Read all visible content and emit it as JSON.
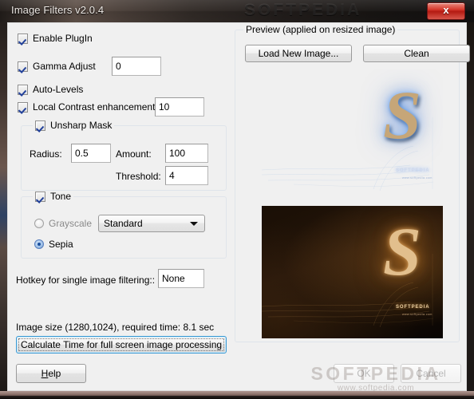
{
  "window": {
    "title": "Image Filters v2.0.4",
    "close_label": "x",
    "watermark": "SOFTPEDIA",
    "watermark_url": "www.softpedia.com"
  },
  "settings": {
    "enable_plugin": {
      "label": "Enable PlugIn",
      "checked": true
    },
    "gamma_adjust": {
      "label": "Gamma Adjust",
      "checked": true,
      "value": "0"
    },
    "auto_levels": {
      "label": "Auto-Levels",
      "checked": true
    },
    "local_contrast": {
      "label": "Local Contrast enhancement",
      "checked": true,
      "value": "10"
    }
  },
  "unsharp_mask": {
    "group_label": "Unsharp Mask",
    "checked": true,
    "radius_label": "Radius:",
    "radius_value": "0.5",
    "amount_label": "Amount:",
    "amount_value": "100",
    "threshold_label": "Threshold:",
    "threshold_value": "4"
  },
  "tone": {
    "group_label": "Tone",
    "checked": true,
    "grayscale_label": "Grayscale",
    "grayscale_selected": false,
    "sepia_label": "Sepia",
    "sepia_selected": true,
    "preset_value": "Standard",
    "preset_options": [
      "Standard"
    ]
  },
  "hotkey": {
    "label": "Hotkey for single image filtering::",
    "value": "None"
  },
  "status": {
    "image_info": "Image size (1280,1024), required time: 8.1 sec",
    "calculate_label": "Calculate Time for full screen image processing"
  },
  "preview": {
    "group_label": "Preview (applied on resized image)",
    "load_button": "Load New Image...",
    "clean_button": "Clean",
    "original": {
      "logo": "S",
      "brand": "SOFTPEDIA",
      "url": "www.softpedia.com"
    },
    "filtered": {
      "logo": "S",
      "brand": "SOFTPEDIA",
      "url": "www.softpedia.com"
    }
  },
  "footer": {
    "help_label": "Help",
    "help_mnemonic": "H",
    "ok_label": "OK",
    "cancel_label": "Cancel"
  },
  "colors": {
    "accent": "#3c9ad4",
    "close_red": "#d6392c",
    "dialog_bg": "#f0f0f0",
    "preview_blue": "#12275c",
    "preview_sepia": "#24150a"
  }
}
